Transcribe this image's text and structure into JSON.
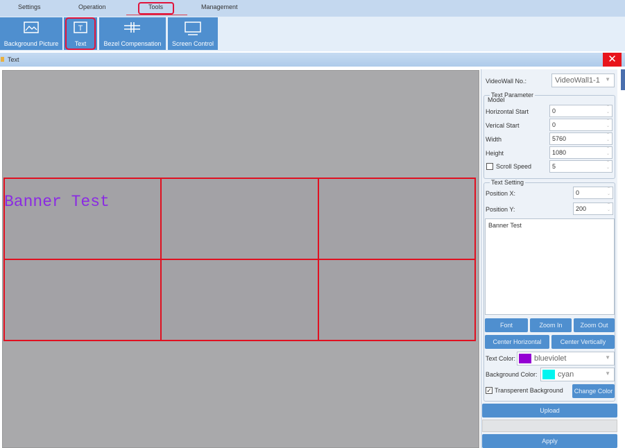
{
  "menu": {
    "items": [
      "Settings",
      "Operation",
      "Tools",
      "Management"
    ],
    "active": "Tools"
  },
  "toolbar": {
    "items": [
      {
        "label": "Background Picture",
        "icon": "image-icon"
      },
      {
        "label": "Text",
        "icon": "text-icon"
      },
      {
        "label": "Bezel Compensation",
        "icon": "bezel-icon"
      },
      {
        "label": "Screen Control",
        "icon": "monitor-icon"
      }
    ]
  },
  "window": {
    "title": "Text",
    "close": "✕"
  },
  "canvas": {
    "banner_text": "Banner Test",
    "banner_color": "#8a2be2",
    "grid_rows": 2,
    "grid_cols": 3,
    "grid_line_color": "#e01020"
  },
  "panel": {
    "videowall_label": "VideoWall No.:",
    "videowall_value": "VideoWall1-1",
    "text_param": {
      "legend": "Text Parameter",
      "model": "Model",
      "h_start_label": "Horizontal Start",
      "h_start": "0",
      "v_start_label": "Verical Start",
      "v_start": "0",
      "width_label": "Width",
      "width": "5760",
      "height_label": "Height",
      "height": "1080",
      "scroll_label": "Scroll Speed",
      "scroll_checked": false,
      "scroll": "5"
    },
    "text_setting": {
      "legend": "Text Setting",
      "pos_x_label": "Position X:",
      "pos_x": "0",
      "pos_y_label": "Position Y:",
      "pos_y": "200",
      "text": "Banner Test",
      "font": "Font",
      "zoom_in": "Zoom In",
      "zoom_out": "Zoom Out",
      "center_h": "Center Horizontal",
      "center_v": "Center Vertically",
      "text_color_label": "Text Color:",
      "text_color": "blueviolet",
      "text_color_hex": "#9400d3",
      "bg_color_label": "Background Color:",
      "bg_color": "cyan",
      "bg_color_hex": "#00ffff",
      "transparent_label": "Transperent Background",
      "transparent_checked": true,
      "change_color": "Change Color"
    },
    "upload": "Upload",
    "apply": "Apply"
  }
}
